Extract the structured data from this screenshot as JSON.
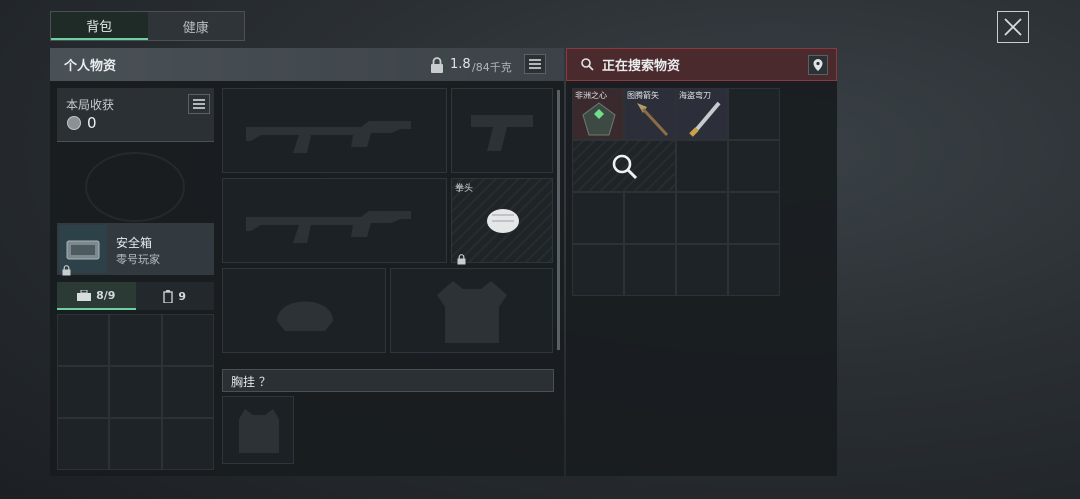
{
  "tabs": [
    {
      "label": "背包"
    },
    {
      "label": "健康"
    }
  ],
  "personal": {
    "title": "个人物资",
    "weight_value": "1.8",
    "weight_max": "/84千克"
  },
  "harvest": {
    "label": "本局收获",
    "value": "0"
  },
  "safebox": {
    "name": "安全箱",
    "sub": "零号玩家"
  },
  "pouch_tabs": [
    {
      "label": "8/9"
    },
    {
      "label": "9"
    }
  ],
  "fist": {
    "label": "拳头"
  },
  "chest": {
    "label": "胸挂 ？"
  },
  "search": {
    "title": "正在搜索物资",
    "items": [
      {
        "label": "非洲之心"
      },
      {
        "label": "图腾箭矢"
      },
      {
        "label": "海盗弯刀"
      }
    ]
  }
}
